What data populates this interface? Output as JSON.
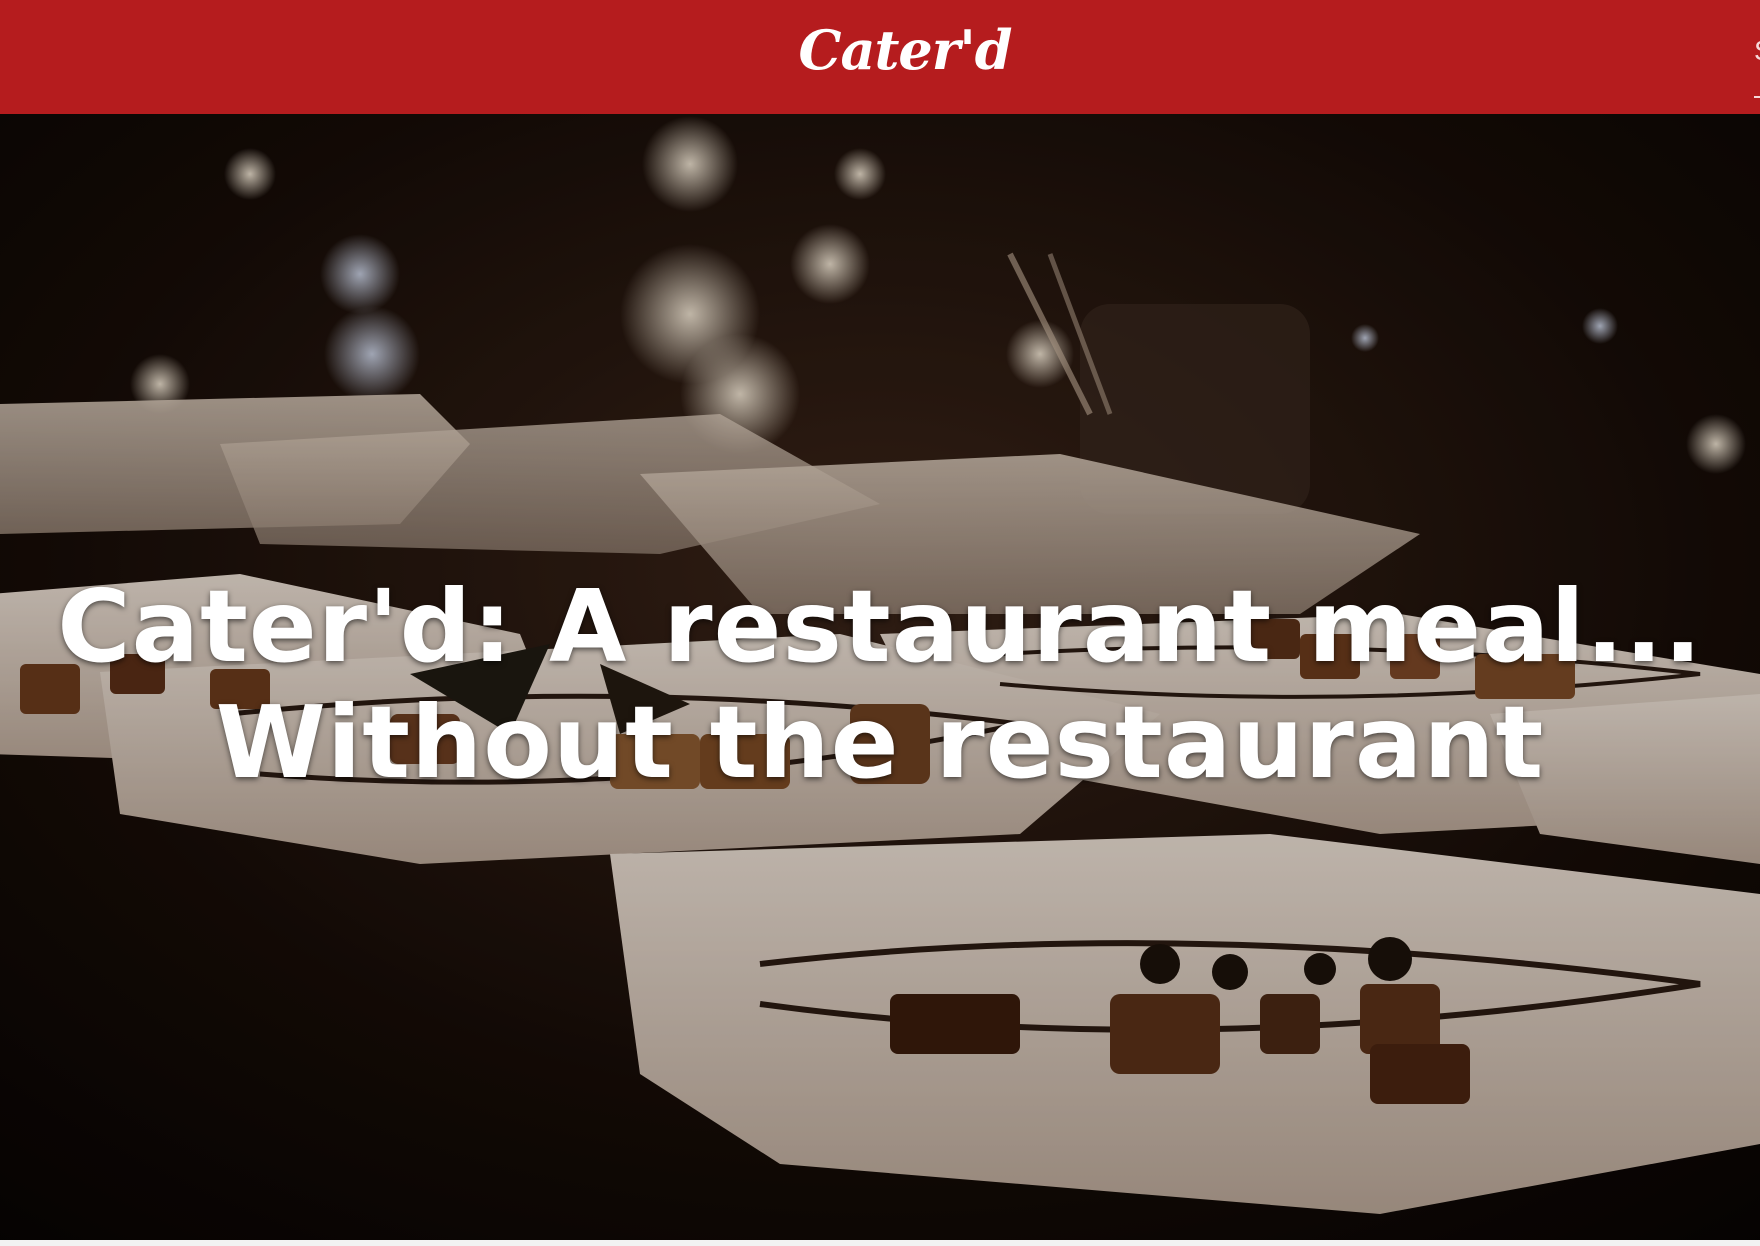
{
  "navbar": {
    "brand": "Cater'd",
    "right_link_visible": "S",
    "background_color": "#b51c1e"
  },
  "hero": {
    "headline_line1": "Cater'd: A restaurant meal...",
    "headline_line2": "Without the restaurant",
    "image_description_icon": "plated-food-photo"
  }
}
